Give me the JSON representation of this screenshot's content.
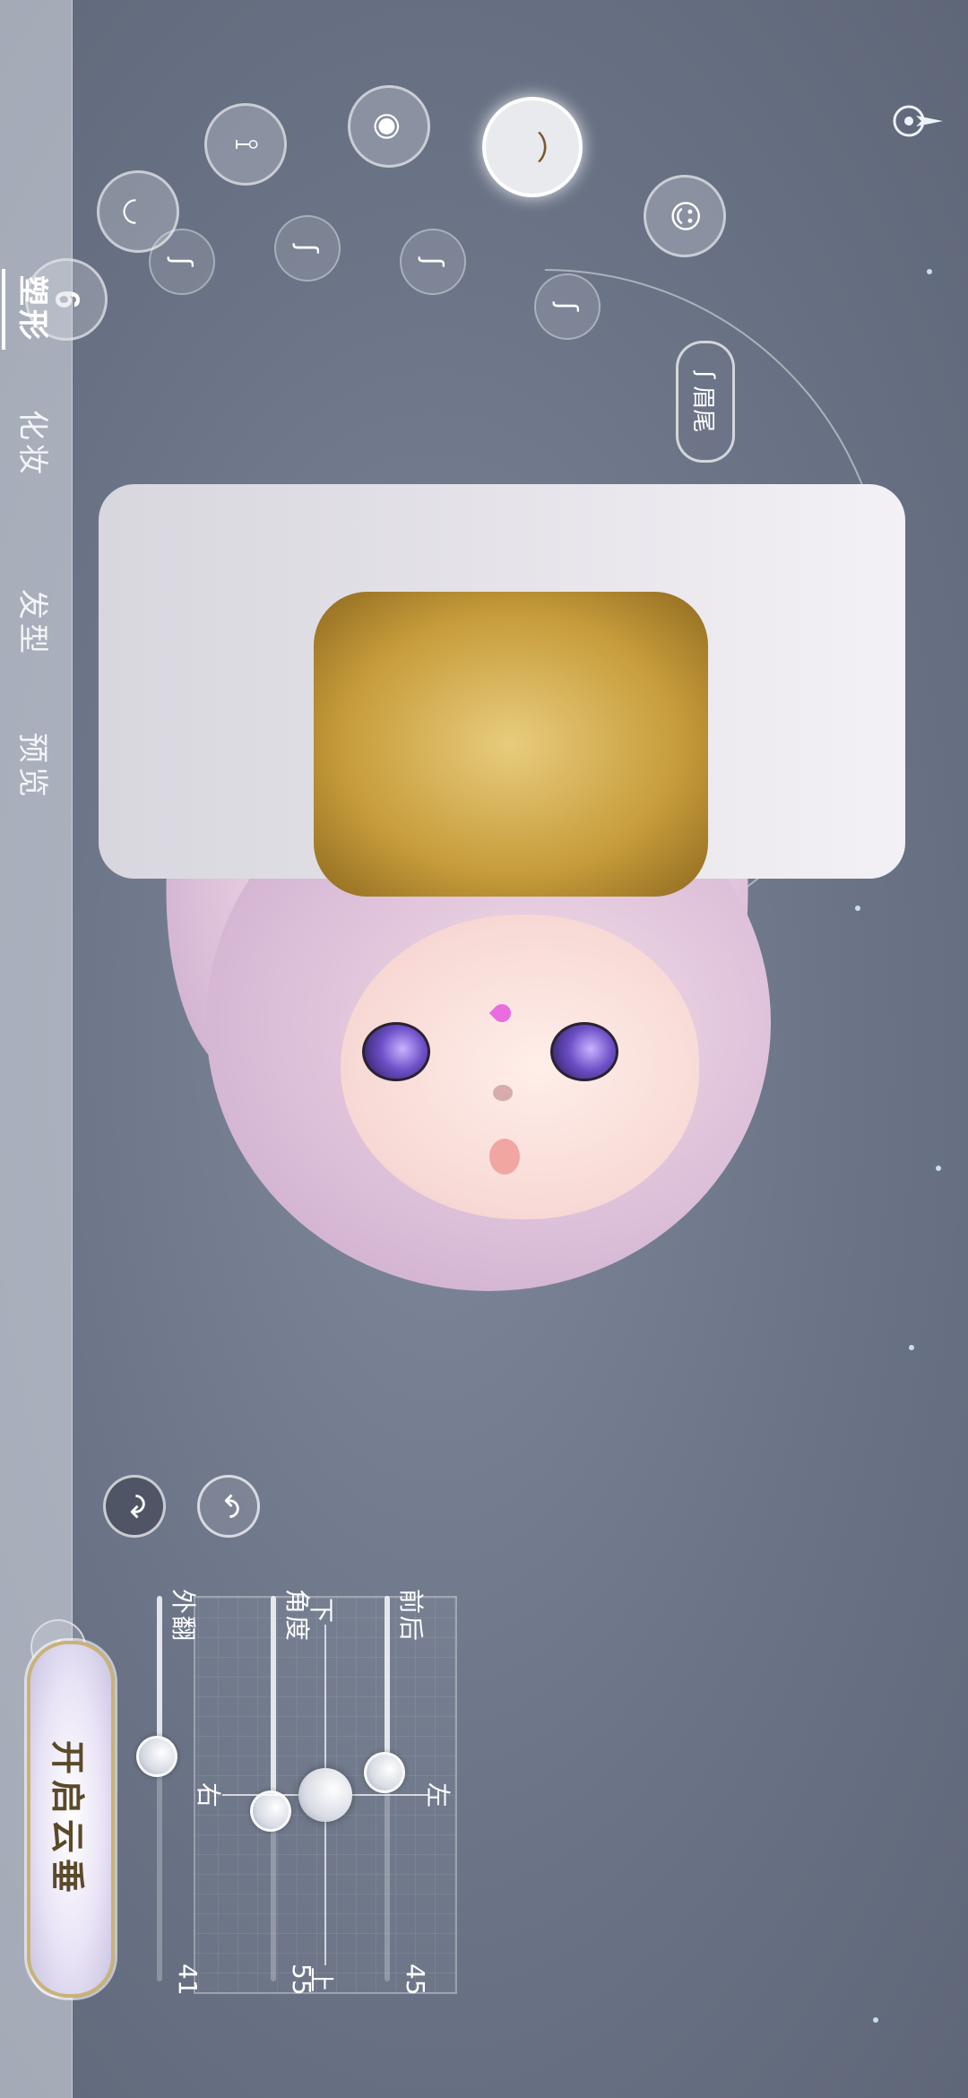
{
  "nav": {
    "tabs": [
      {
        "label": "塑形",
        "active": true
      },
      {
        "label": "化妆",
        "active": false
      },
      {
        "label": "发型",
        "active": false
      },
      {
        "label": "预览",
        "active": false
      }
    ]
  },
  "features": {
    "icons": [
      "ear-icon",
      "lips-icon",
      "nose-icon",
      "eye-icon",
      "eyebrow-icon",
      "face-icon"
    ],
    "selected": "eyebrow-icon",
    "sub_icons": [
      "eyebrow-shape-1-icon",
      "eyebrow-shape-2-icon",
      "eyebrow-shape-3-icon",
      "eyebrow-shape-4-icon"
    ],
    "current_part_label": "眉尾"
  },
  "sliders": [
    {
      "label": "前后",
      "value": "45",
      "fraction": 0.45
    },
    {
      "label": "角度",
      "value": "55",
      "fraction": 0.55
    },
    {
      "label": "外翻",
      "value": "41",
      "fraction": 0.41
    }
  ],
  "pad": {
    "up": "左",
    "down": "右",
    "left": "下",
    "right": "上"
  },
  "action_buttons": {
    "undo": "undo-icon",
    "redo": "redo-icon"
  },
  "tools": [
    "pose-icon",
    "light-icon",
    "hide-icon",
    "fullscreen-icon",
    "camera-icon"
  ],
  "cloud_button": "开启云垂",
  "colors": {
    "accent_gold": "#c9b27a",
    "knob": "#d9dce4"
  }
}
